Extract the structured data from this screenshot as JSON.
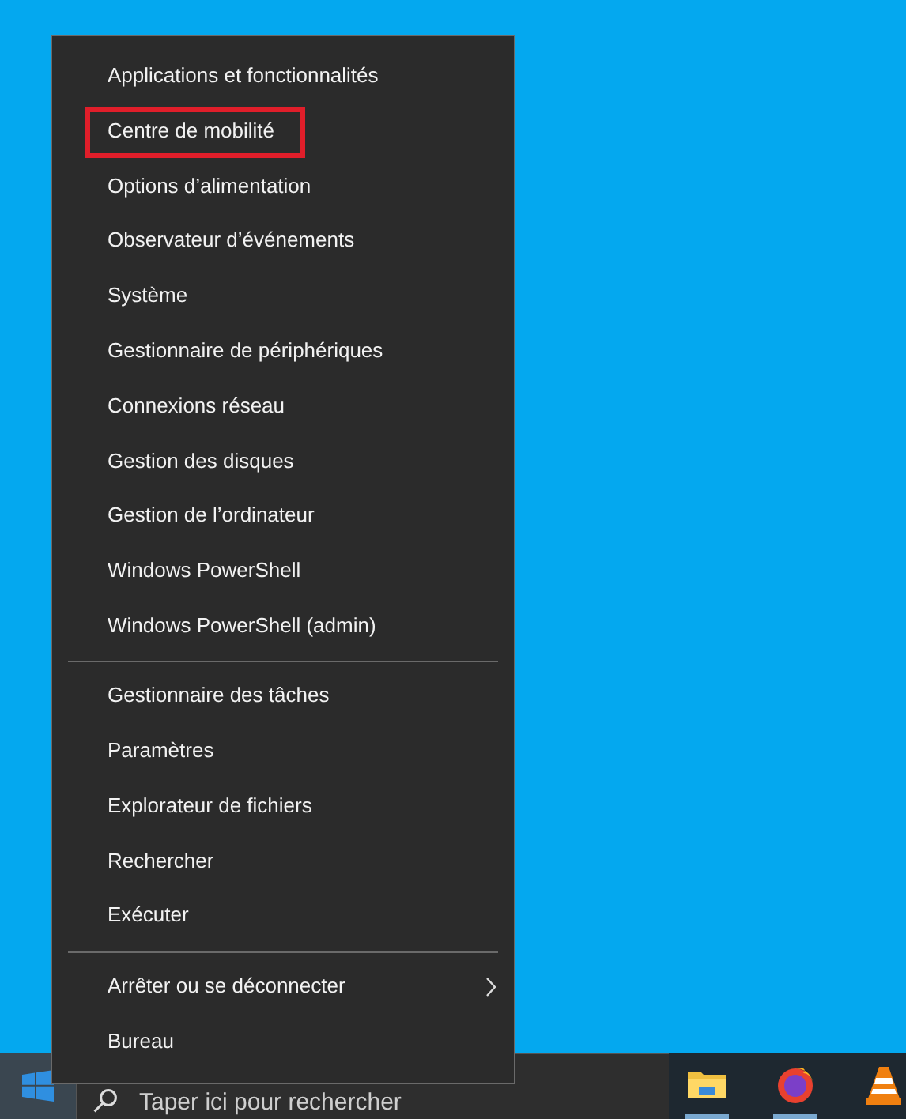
{
  "menu": {
    "groups": [
      {
        "items": [
          {
            "label": "Applications et fonctionnalités",
            "kind": "plain",
            "highlighted": false
          },
          {
            "label": "Centre de mobilité",
            "kind": "plain",
            "highlighted": true
          },
          {
            "label": "Options d’alimentation",
            "kind": "plain",
            "highlighted": false
          },
          {
            "label": "Observateur d’événements",
            "kind": "plain",
            "highlighted": false
          },
          {
            "label": "Système",
            "kind": "plain",
            "highlighted": false
          },
          {
            "label": "Gestionnaire de périphériques",
            "kind": "plain",
            "highlighted": false
          },
          {
            "label": "Connexions réseau",
            "kind": "plain",
            "highlighted": false
          },
          {
            "label": "Gestion des disques",
            "kind": "plain",
            "highlighted": false
          },
          {
            "label": "Gestion de l’ordinateur",
            "kind": "plain",
            "highlighted": false
          },
          {
            "label": "Windows PowerShell",
            "kind": "plain",
            "highlighted": false
          },
          {
            "label": "Windows PowerShell (admin)",
            "kind": "plain",
            "highlighted": false
          }
        ]
      },
      {
        "items": [
          {
            "label": "Gestionnaire des tâches",
            "kind": "plain",
            "highlighted": false
          },
          {
            "label": "Paramètres",
            "kind": "plain",
            "highlighted": false
          },
          {
            "label": "Explorateur de fichiers",
            "kind": "plain",
            "highlighted": false
          },
          {
            "label": "Rechercher",
            "kind": "plain",
            "highlighted": false
          },
          {
            "label": "Exécuter",
            "kind": "plain",
            "highlighted": false
          }
        ]
      },
      {
        "items": [
          {
            "label": "Arrêter ou se déconnecter",
            "kind": "submenu",
            "highlighted": false
          },
          {
            "label": "Bureau",
            "kind": "plain",
            "highlighted": false
          }
        ]
      }
    ]
  },
  "taskbar": {
    "search": {
      "placeholder": "Taper ici pour rechercher"
    },
    "apps": [
      {
        "kind": "folder",
        "running": true
      },
      {
        "kind": "firefox",
        "running": true
      },
      {
        "kind": "cone",
        "running": false
      }
    ]
  }
}
